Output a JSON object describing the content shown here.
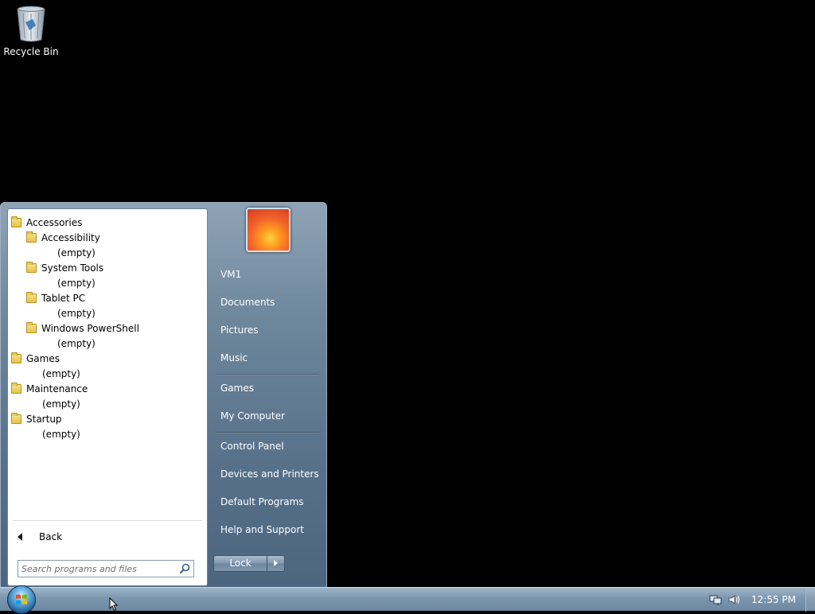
{
  "desktop": {
    "icons": [
      {
        "label": "Recycle Bin",
        "icon": "recycle-bin-icon"
      }
    ]
  },
  "start_menu": {
    "programs_tree": [
      {
        "label": "Accessories",
        "type": "folder",
        "level": 0
      },
      {
        "label": "Accessibility",
        "type": "folder",
        "level": 1
      },
      {
        "label": "(empty)",
        "type": "empty",
        "level": 2
      },
      {
        "label": "System Tools",
        "type": "folder",
        "level": 1
      },
      {
        "label": "(empty)",
        "type": "empty",
        "level": 2
      },
      {
        "label": "Tablet PC",
        "type": "folder",
        "level": 1
      },
      {
        "label": "(empty)",
        "type": "empty",
        "level": 2
      },
      {
        "label": "Windows PowerShell",
        "type": "folder",
        "level": 1
      },
      {
        "label": "(empty)",
        "type": "empty",
        "level": 2
      },
      {
        "label": "Games",
        "type": "folder",
        "level": 0
      },
      {
        "label": "(empty)",
        "type": "empty",
        "level": 1
      },
      {
        "label": "Maintenance",
        "type": "folder",
        "level": 0
      },
      {
        "label": "(empty)",
        "type": "empty",
        "level": 1
      },
      {
        "label": "Startup",
        "type": "folder",
        "level": 0
      },
      {
        "label": "(empty)",
        "type": "empty",
        "level": 1
      }
    ],
    "back_label": "Back",
    "search_placeholder": "Search programs and files",
    "right_items": [
      {
        "label": "VM1",
        "group": 1
      },
      {
        "label": "Documents",
        "group": 1
      },
      {
        "label": "Pictures",
        "group": 1
      },
      {
        "label": "Music",
        "group": 1
      },
      {
        "label": "Games",
        "group": 2
      },
      {
        "label": "My Computer",
        "group": 2
      },
      {
        "label": "Control Panel",
        "group": 3
      },
      {
        "label": "Devices and Printers",
        "group": 3
      },
      {
        "label": "Default Programs",
        "group": 3
      },
      {
        "label": "Help and Support",
        "group": 3
      }
    ],
    "shutdown_label": "Lock"
  },
  "taskbar": {
    "clock": "12:55 PM",
    "tray_icons": [
      "network-icon",
      "volume-icon"
    ]
  }
}
